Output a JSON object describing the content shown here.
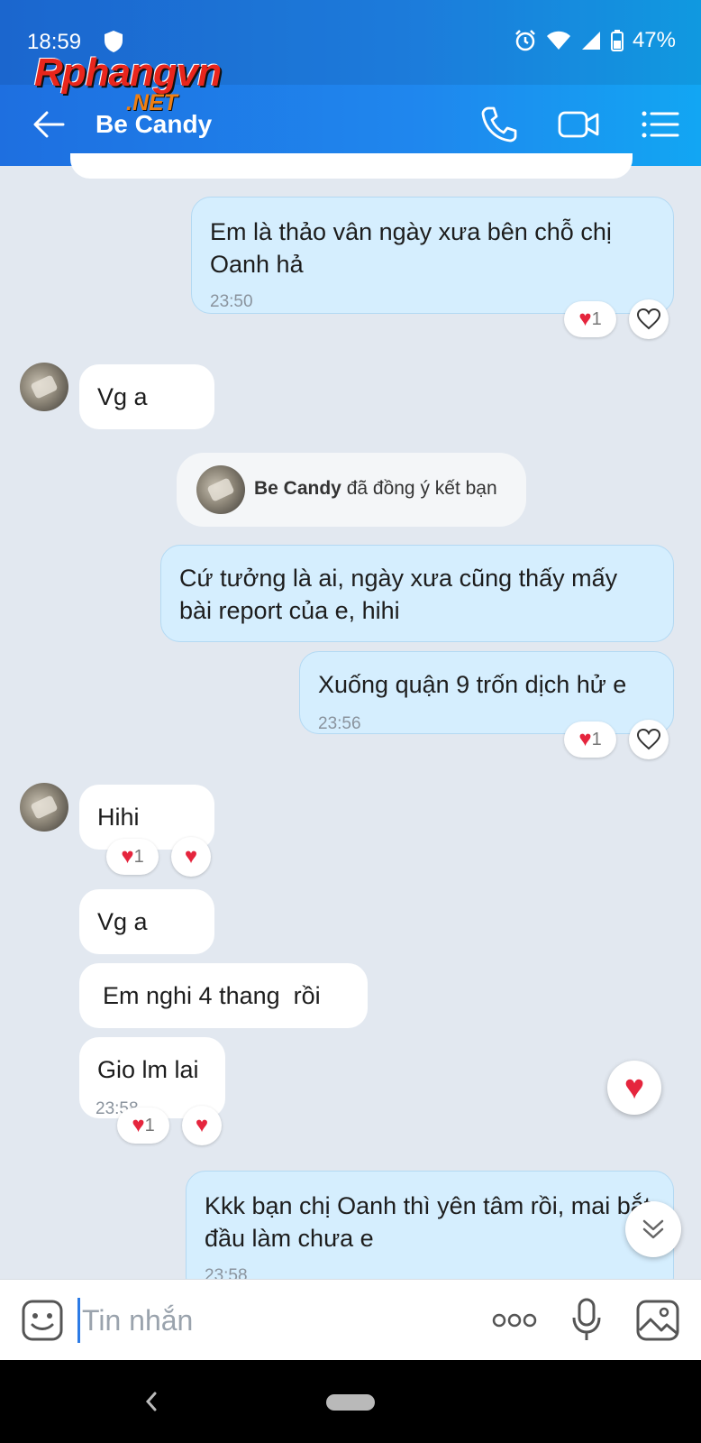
{
  "status_bar": {
    "time": "18:59",
    "battery": "47%"
  },
  "watermark": {
    "main": "Rphangvn",
    "sub": ".NET"
  },
  "header": {
    "title": "Be Candy"
  },
  "messages": [
    {
      "text": "Em là thảo vân ngày xưa bên chỗ chị Oanh hả",
      "time": "23:50",
      "reaction_count": "1"
    },
    {
      "text": "Vg a"
    },
    {
      "text": "Cứ tưởng là ai, ngày xưa cũng thấy mấy bài report của e, hihi"
    },
    {
      "text": "Xuống quận 9 trốn dịch hử e",
      "time": "23:56",
      "reaction_count": "1"
    },
    {
      "text": "Hihi",
      "reaction_count": "1"
    },
    {
      "text": "Vg a"
    },
    {
      "text": "Em nghi 4 thang  rồi"
    },
    {
      "text": "Gio lm lai",
      "time": "23:58",
      "reaction_count": "1"
    },
    {
      "text": "Kkk bạn chị Oanh thì yên tâm rồi, mai bắt đầu làm chưa e",
      "time": "23:58"
    }
  ],
  "system_message": {
    "name": "Be Candy",
    "text": "đã đồng ý kết bạn"
  },
  "input": {
    "placeholder": "Tin nhắn"
  },
  "colors": {
    "header": "#1f87ee",
    "sent_bubble": "#d5eefe",
    "heart": "#e5253d"
  }
}
